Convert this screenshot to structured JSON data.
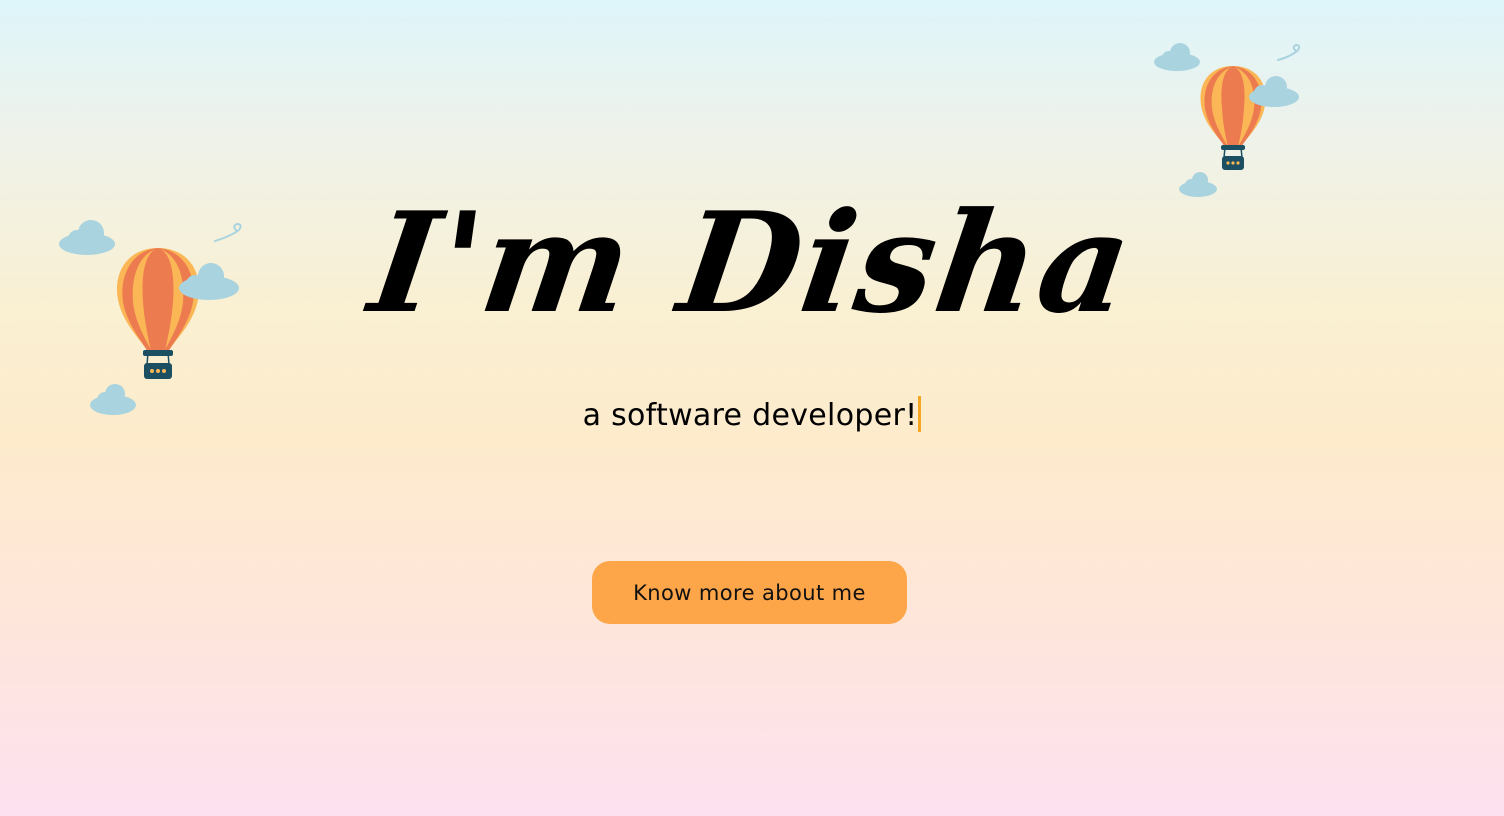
{
  "hero": {
    "title": "I'm Disha",
    "subtitle": "a software developer!"
  },
  "cta": {
    "label": "Know more about me"
  },
  "colors": {
    "button": "#fda549",
    "cursor": "#f5a623",
    "cloud": "#a8d3df",
    "balloon_red": "#ec7b4f",
    "balloon_yellow": "#fbb656",
    "basket": "#1d4f63"
  },
  "decorations": [
    "hot-air-balloon",
    "hot-air-balloon"
  ]
}
